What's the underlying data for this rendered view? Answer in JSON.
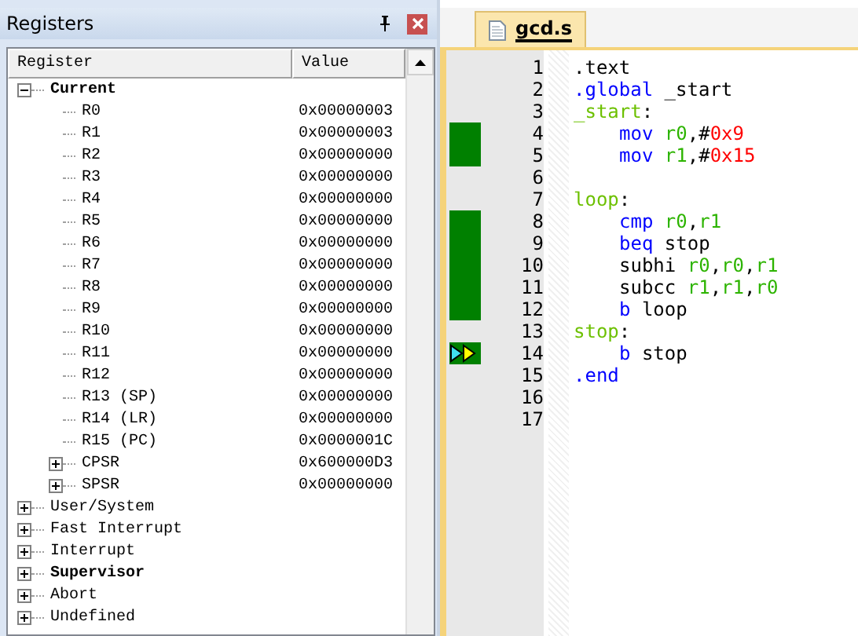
{
  "registers_panel": {
    "title": "Registers",
    "columns": [
      "Register",
      "Value"
    ],
    "tree": [
      {
        "label": "Current",
        "active": true,
        "expanded": true,
        "children": [
          {
            "label": "R0",
            "value": "0x00000003"
          },
          {
            "label": "R1",
            "value": "0x00000003"
          },
          {
            "label": "R2",
            "value": "0x00000000"
          },
          {
            "label": "R3",
            "value": "0x00000000"
          },
          {
            "label": "R4",
            "value": "0x00000000"
          },
          {
            "label": "R5",
            "value": "0x00000000"
          },
          {
            "label": "R6",
            "value": "0x00000000"
          },
          {
            "label": "R7",
            "value": "0x00000000"
          },
          {
            "label": "R8",
            "value": "0x00000000"
          },
          {
            "label": "R9",
            "value": "0x00000000"
          },
          {
            "label": "R10",
            "value": "0x00000000"
          },
          {
            "label": "R11",
            "value": "0x00000000"
          },
          {
            "label": "R12",
            "value": "0x00000000"
          },
          {
            "label": "R13 (SP)",
            "value": "0x00000000"
          },
          {
            "label": "R14 (LR)",
            "value": "0x00000000"
          },
          {
            "label": "R15 (PC)",
            "value": "0x0000001C"
          },
          {
            "label": "CPSR",
            "value": "0x600000D3",
            "expanded": false
          },
          {
            "label": "SPSR",
            "value": "0x00000000",
            "expanded": false
          }
        ]
      },
      {
        "label": "User/System",
        "active": false,
        "expanded": false
      },
      {
        "label": "Fast Interrupt",
        "active": false,
        "expanded": false
      },
      {
        "label": "Interrupt",
        "active": false,
        "expanded": false
      },
      {
        "label": "Supervisor",
        "active": true,
        "expanded": false
      },
      {
        "label": "Abort",
        "active": false,
        "expanded": false
      },
      {
        "label": "Undefined",
        "active": false,
        "expanded": false
      }
    ]
  },
  "editor": {
    "tabs": [
      {
        "label": "gcd.s",
        "selected": true
      }
    ],
    "lines": [
      {
        "number": "1",
        "executed": false,
        "current": false,
        "indented": false,
        "tokens": [
          {
            "kind": "plain",
            "text": ".text"
          }
        ]
      },
      {
        "number": "2",
        "executed": false,
        "current": false,
        "indented": false,
        "tokens": [
          {
            "kind": "keyword",
            "text": ".global"
          },
          {
            "kind": "plain",
            "text": " _start"
          }
        ]
      },
      {
        "number": "3",
        "executed": false,
        "current": false,
        "indented": false,
        "tokens": [
          {
            "kind": "label",
            "text": "_start"
          },
          {
            "kind": "plain",
            "text": ":"
          }
        ]
      },
      {
        "number": "4",
        "executed": true,
        "current": false,
        "indented": true,
        "tokens": [
          {
            "kind": "keyword",
            "text": "mov "
          },
          {
            "kind": "register",
            "text": "r0"
          },
          {
            "kind": "plain",
            "text": ",#"
          },
          {
            "kind": "number",
            "text": "0x9"
          }
        ]
      },
      {
        "number": "5",
        "executed": true,
        "current": false,
        "indented": true,
        "tokens": [
          {
            "kind": "keyword",
            "text": "mov "
          },
          {
            "kind": "register",
            "text": "r1"
          },
          {
            "kind": "plain",
            "text": ",#"
          },
          {
            "kind": "number",
            "text": "0x15"
          }
        ]
      },
      {
        "number": "6",
        "executed": false,
        "current": false
      },
      {
        "number": "7",
        "executed": false,
        "current": false,
        "indented": false,
        "tokens": [
          {
            "kind": "label",
            "text": "loop"
          },
          {
            "kind": "plain",
            "text": ":"
          }
        ]
      },
      {
        "number": "8",
        "executed": true,
        "current": false,
        "indented": true,
        "tokens": [
          {
            "kind": "keyword",
            "text": "cmp "
          },
          {
            "kind": "register",
            "text": "r0"
          },
          {
            "kind": "plain",
            "text": ","
          },
          {
            "kind": "register",
            "text": "r1"
          }
        ]
      },
      {
        "number": "9",
        "executed": true,
        "current": false,
        "indented": true,
        "tokens": [
          {
            "kind": "keyword",
            "text": "beq"
          },
          {
            "kind": "plain",
            "text": " stop"
          }
        ]
      },
      {
        "number": "10",
        "executed": true,
        "current": false,
        "indented": true,
        "tokens": [
          {
            "kind": "plain",
            "text": "subhi "
          },
          {
            "kind": "register",
            "text": "r0"
          },
          {
            "kind": "plain",
            "text": ","
          },
          {
            "kind": "register",
            "text": "r0"
          },
          {
            "kind": "plain",
            "text": ","
          },
          {
            "kind": "register",
            "text": "r1"
          }
        ]
      },
      {
        "number": "11",
        "executed": true,
        "current": false,
        "indented": true,
        "tokens": [
          {
            "kind": "plain",
            "text": "subcc "
          },
          {
            "kind": "register",
            "text": "r1"
          },
          {
            "kind": "plain",
            "text": ","
          },
          {
            "kind": "register",
            "text": "r1"
          },
          {
            "kind": "plain",
            "text": ","
          },
          {
            "kind": "register",
            "text": "r0"
          }
        ]
      },
      {
        "number": "12",
        "executed": true,
        "current": false,
        "indented": true,
        "tokens": [
          {
            "kind": "keyword",
            "text": "b"
          },
          {
            "kind": "plain",
            "text": " loop"
          }
        ]
      },
      {
        "number": "13",
        "executed": false,
        "current": false,
        "indented": false,
        "tokens": [
          {
            "kind": "label",
            "text": "stop"
          },
          {
            "kind": "plain",
            "text": ":"
          }
        ]
      },
      {
        "number": "14",
        "executed": true,
        "current": true,
        "indented": true,
        "tokens": [
          {
            "kind": "keyword",
            "text": "b"
          },
          {
            "kind": "plain",
            "text": " stop"
          }
        ]
      },
      {
        "number": "15",
        "executed": false,
        "current": false,
        "indented": false,
        "tokens": [
          {
            "kind": "keyword",
            "text": ".end"
          }
        ]
      },
      {
        "number": "16",
        "executed": false,
        "current": false
      },
      {
        "number": "17",
        "executed": false,
        "current": false
      }
    ]
  }
}
